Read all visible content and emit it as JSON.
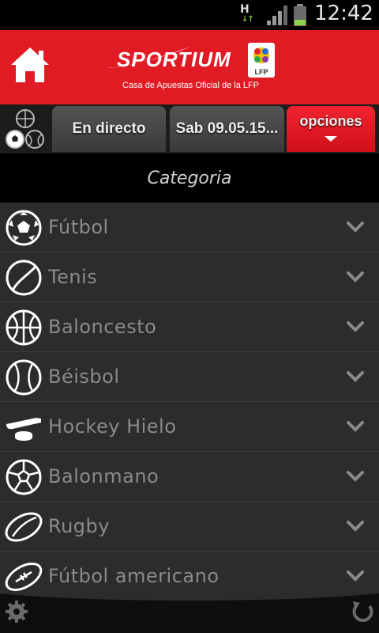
{
  "status_bar": {
    "network": "H",
    "time": "12:42",
    "icons": [
      "network-h-icon",
      "signal-icon",
      "battery-icon"
    ]
  },
  "header": {
    "brand": "SPORTIUM",
    "tagline": "Casa de Apuestas Oficial de la LFP",
    "badge_text": "LFP",
    "colors": {
      "accent": "#e01b24"
    }
  },
  "tabs": {
    "live_label": "En directo",
    "date_label": "Sab 09.05.15...",
    "options_label": "opciones"
  },
  "category_heading": "Categoria",
  "categories": [
    {
      "label": "Fútbol",
      "icon": "soccer-ball-icon"
    },
    {
      "label": "Tenis",
      "icon": "tennis-ball-icon"
    },
    {
      "label": "Baloncesto",
      "icon": "basketball-icon"
    },
    {
      "label": "Béisbol",
      "icon": "baseball-icon"
    },
    {
      "label": "Hockey Hielo",
      "icon": "hockey-stick-icon"
    },
    {
      "label": "Balonmano",
      "icon": "handball-icon"
    },
    {
      "label": "Rugby",
      "icon": "rugby-ball-icon"
    },
    {
      "label": "Fútbol americano",
      "icon": "american-football-icon"
    }
  ]
}
